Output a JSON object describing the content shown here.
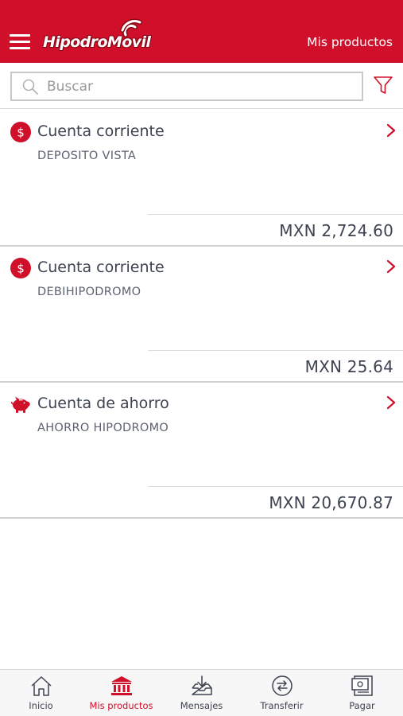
{
  "colors": {
    "brand": "#d0102a",
    "text": "#3d4350",
    "divider": "#cfcfcf"
  },
  "header": {
    "menu_icon": "hamburger-menu-icon",
    "logo_text": "HipodroMovil",
    "title": "Mis productos"
  },
  "search": {
    "placeholder": "Buscar",
    "value": "",
    "icon": "search-icon",
    "filter_icon": "filter-funnel-icon"
  },
  "products": [
    {
      "icon": "dollar-coin-icon",
      "title": "Cuenta corriente",
      "subtitle": "DEPOSITO VISTA",
      "amount": "MXN 2,724.60"
    },
    {
      "icon": "dollar-coin-icon",
      "title": "Cuenta corriente",
      "subtitle": "DEBIHIPODROMO",
      "amount": "MXN 25.64"
    },
    {
      "icon": "piggy-bank-icon",
      "title": "Cuenta de ahorro",
      "subtitle": "AHORRO HIPODROMO",
      "amount": "MXN 20,670.87"
    }
  ],
  "tabs": [
    {
      "label": "Inicio",
      "icon": "home-icon",
      "active": false
    },
    {
      "label": "Mis productos",
      "icon": "bank-icon",
      "active": true
    },
    {
      "label": "Mensajes",
      "icon": "inbox-download-icon",
      "active": false
    },
    {
      "label": "Transferir",
      "icon": "transfer-arrows-icon",
      "active": false
    },
    {
      "label": "Pagar",
      "icon": "bill-payment-icon",
      "active": false
    }
  ]
}
